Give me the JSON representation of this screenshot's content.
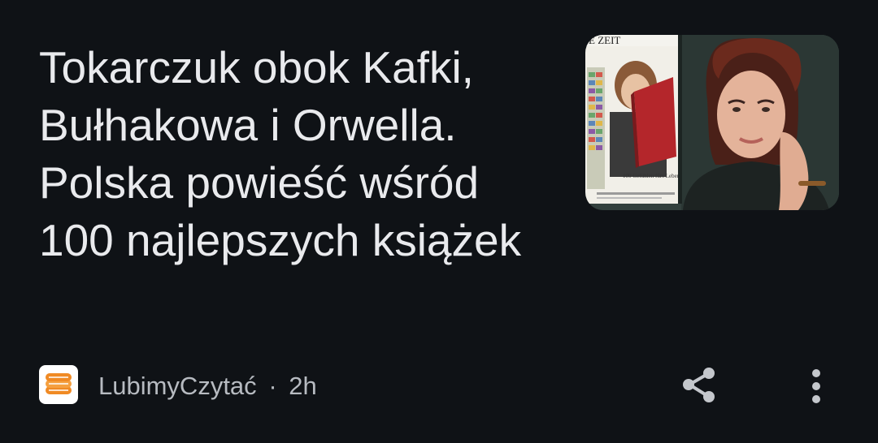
{
  "article": {
    "headline": "Tokarczuk obok Kafki, Bułhakowa i Orwella. Polska powieść wśród 100 najlepszych książek",
    "thumbnail": {
      "icon": "article-photo",
      "masthead_text": "E ZEIT",
      "cover_text": "100 Gefühlen fürs Leben"
    }
  },
  "footer": {
    "source_icon": "lubimyczytac-logo-icon",
    "source_name": "LubimyCzytać",
    "separator": "·",
    "age": "2h",
    "share_icon": "share-icon",
    "more_icon": "more-vert-icon"
  },
  "colors": {
    "background": "#0f1216",
    "headline": "#e9eaed",
    "meta": "#b7bbc1",
    "icon": "#c4c7cc",
    "brand_orange": "#f08a24"
  }
}
